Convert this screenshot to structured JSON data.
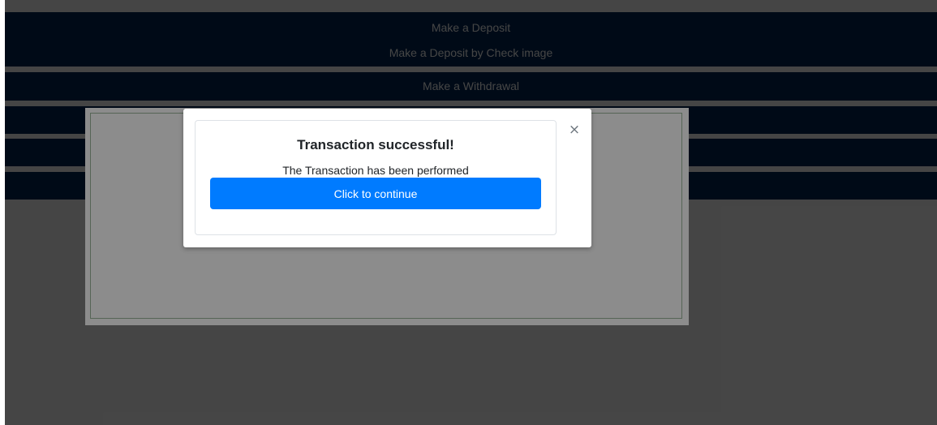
{
  "menu": {
    "items": [
      {
        "label": "Make a Deposit"
      },
      {
        "label": "Make a Deposit by Check image"
      },
      {
        "label": "Make a Withdrawal"
      }
    ]
  },
  "modal": {
    "title": "Transaction successful!",
    "message": "The Transaction has been performed",
    "continue_label": "Click to continue",
    "close_glyph": "×"
  },
  "colors": {
    "menu_background": "#002654",
    "primary_button": "#007bff",
    "overlay": "#444444"
  },
  "icons": {
    "close": "close-icon"
  }
}
